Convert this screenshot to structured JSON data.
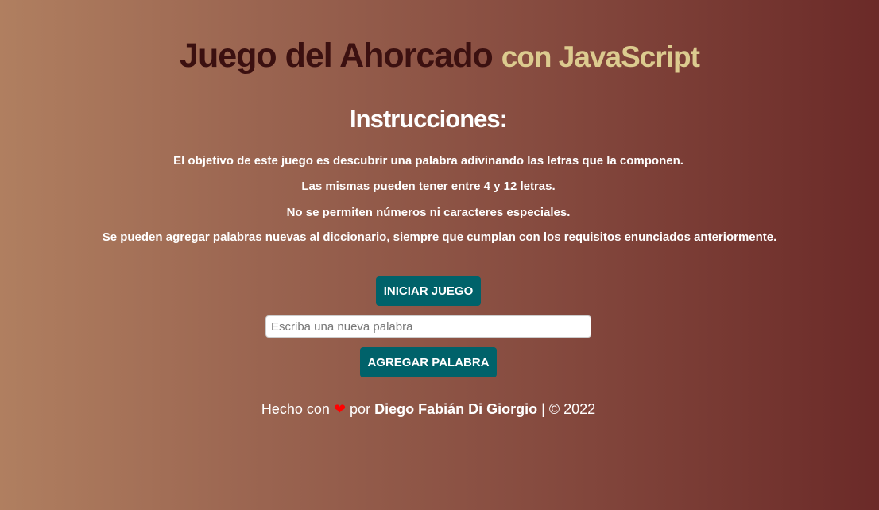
{
  "header": {
    "title": "Juego del Ahorcado",
    "title_accent": "con JavaScript"
  },
  "instructions": {
    "heading": "Instrucciones:",
    "lines": [
      "El objetivo de este juego es descubrir una palabra adivinando las letras que la componen.",
      "Las mismas pueden tener entre 4 y 12 letras.",
      "No se permiten números ni caracteres especiales.",
      "Se pueden agregar palabras nuevas al diccionario, siempre que cumplan con los requisitos enunciados anteriormente."
    ]
  },
  "controls": {
    "start_label": "INICIAR JUEGO",
    "word_placeholder": "Escriba una nueva palabra",
    "word_value": "",
    "add_label": "AGREGAR PALABRA"
  },
  "footer": {
    "made_with": "Hecho con",
    "heart": "❤",
    "by": "por",
    "author": "Diego Fabián Di Giorgio",
    "separator": "|",
    "copyright": "© 2022"
  },
  "colors": {
    "button": "#00626a",
    "title": "#3b1010",
    "accent": "#dccb8f"
  }
}
